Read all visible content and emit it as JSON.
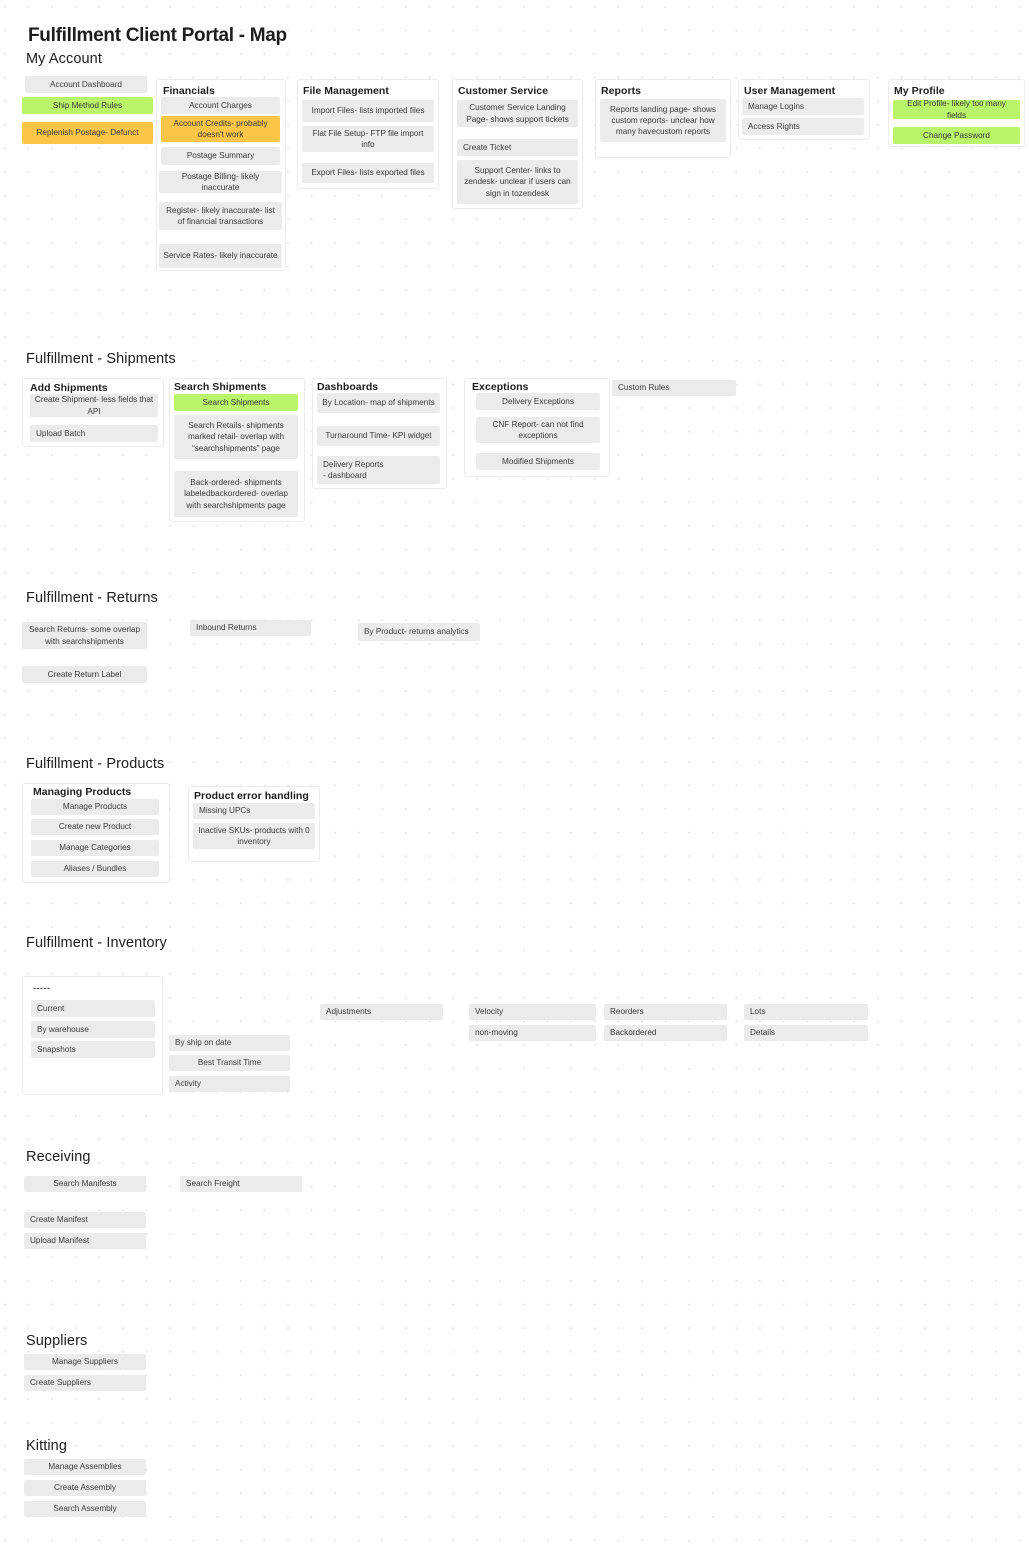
{
  "page": {
    "title": "Fulfillment Client Portal - Map",
    "colors": {
      "chip_default": "#ebebeb",
      "chip_green": "#b9f46a",
      "chip_orange": "#fbc647",
      "group_border": "#ececec",
      "dot_grid": "#e3e3e6",
      "background": "#ffffff",
      "text": "#3a3a3a"
    }
  },
  "sections": {
    "my_account": {
      "title": "My Account",
      "loose_items": [
        {
          "label": "Account Dashboard",
          "style": "default"
        },
        {
          "label": "Ship Method Rules",
          "style": "green"
        },
        {
          "label": "Replenish Postage- Defunct",
          "style": "orange"
        }
      ],
      "groups": [
        {
          "title": "Financials",
          "items": [
            {
              "label": "Account Charges",
              "style": "default"
            },
            {
              "label": "Account Credits- probably doesn't work",
              "style": "orange"
            },
            {
              "label": "Postage Summary",
              "style": "default"
            },
            {
              "label": "Postage Billing- likely inaccurate",
              "style": "default"
            },
            {
              "label": "Register- likely inaccurate- list of financial transactions",
              "style": "default"
            },
            {
              "label": "Service Rates- likely inaccurate",
              "style": "default"
            }
          ]
        },
        {
          "title": "File Management",
          "items": [
            {
              "label": "Import Files- lists imported files",
              "style": "default"
            },
            {
              "label": "Flat File Setup- FTP file import info",
              "style": "default"
            },
            {
              "label": "Export Files- lists exported files",
              "style": "default"
            }
          ]
        },
        {
          "title": "Customer Service",
          "items": [
            {
              "label": "Customer Service Landing Page- shows support tickets",
              "style": "default"
            },
            {
              "label": "Create Ticket",
              "style": "default"
            },
            {
              "label": "Support Center- links to zendesk- unclear if users can sign in tozendesk",
              "style": "default"
            }
          ]
        },
        {
          "title": "Reports",
          "items": [
            {
              "label": "Reports landing page- shows custom reports- unclear how many havecustom reports",
              "style": "default"
            }
          ]
        },
        {
          "title": "User Management",
          "items": [
            {
              "label": "Manage Logins",
              "style": "default"
            },
            {
              "label": "Access Rights",
              "style": "default"
            }
          ]
        },
        {
          "title": "My Profile",
          "items": [
            {
              "label": "Edit Profile- likely too many fields",
              "style": "green"
            },
            {
              "label": "Change Password",
              "style": "green"
            }
          ]
        }
      ]
    },
    "shipments": {
      "title": "Fulfillment - Shipments",
      "groups": [
        {
          "title": "Add Shipments",
          "items": [
            {
              "label": "Create Shipment- less fields that API",
              "style": "default"
            },
            {
              "label": "Upload Batch",
              "style": "default"
            }
          ]
        },
        {
          "title": "Search Shipments",
          "items": [
            {
              "label": "Search Shipments",
              "style": "green"
            },
            {
              "label": "Search Retails- shipments marked retail- overlap with “searchshipments” page",
              "style": "default"
            },
            {
              "label": "Back-ordered- shipments labeledbackordered- overlap with searchshipments page",
              "style": "default"
            }
          ]
        },
        {
          "title": "Dashboards",
          "items": [
            {
              "label": "By Location- map of shipments",
              "style": "default"
            },
            {
              "label": "Turnaround Time- KPI widget",
              "style": "default"
            },
            {
              "label": "Delivery Reports\n- dashboard",
              "style": "default"
            }
          ]
        },
        {
          "title": "Exceptions",
          "items": [
            {
              "label": "Delivery Exceptions",
              "style": "default"
            },
            {
              "label": "CNF Report- can not find exceptions",
              "style": "default"
            },
            {
              "label": "Modified Shipments",
              "style": "default"
            }
          ]
        }
      ],
      "loose_items": [
        {
          "label": "Custom Rules",
          "style": "default"
        }
      ]
    },
    "returns": {
      "title": "Fulfillment - Returns",
      "loose_items": [
        {
          "label": "Search Returns- some overlap with searchshipments",
          "style": "default"
        },
        {
          "label": "Create Return Label",
          "style": "default"
        },
        {
          "label": "Inbound Returns",
          "style": "default"
        },
        {
          "label": "By Product- returns analytics",
          "style": "default"
        }
      ]
    },
    "products": {
      "title": "Fulfillment - Products",
      "groups": [
        {
          "title": "Managing Products",
          "items": [
            {
              "label": "Manage Products",
              "style": "default"
            },
            {
              "label": "Create new Product",
              "style": "default"
            },
            {
              "label": "Manage Categories",
              "style": "default"
            },
            {
              "label": "Aliases / Bundles",
              "style": "default"
            }
          ]
        },
        {
          "title": "Product error handling",
          "items": [
            {
              "label": "Missing UPCs",
              "style": "default"
            },
            {
              "label": "Inactive SKUs- products with 0 inventory",
              "style": "default"
            }
          ]
        }
      ]
    },
    "inventory": {
      "title": "Fulfillment - Inventory",
      "groups": [
        {
          "title": "-----",
          "items": [
            {
              "label": "Current",
              "style": "default"
            },
            {
              "label": "By warehouse",
              "style": "default"
            },
            {
              "label": "Snapshots",
              "style": "default"
            }
          ]
        }
      ],
      "loose_items": [
        {
          "label": "By ship on date",
          "style": "default"
        },
        {
          "label": "Best Transit Time",
          "style": "default"
        },
        {
          "label": "Activity",
          "style": "default"
        },
        {
          "label": "Adjustments",
          "style": "default"
        },
        {
          "label": "Velocity",
          "style": "default"
        },
        {
          "label": "non-moving",
          "style": "default"
        },
        {
          "label": "Reorders",
          "style": "default"
        },
        {
          "label": "Backordered",
          "style": "default"
        },
        {
          "label": "Lots",
          "style": "default"
        },
        {
          "label": "Details",
          "style": "default"
        }
      ]
    },
    "receiving": {
      "title": "Receiving",
      "loose_items": [
        {
          "label": "Search Manifests",
          "style": "default"
        },
        {
          "label": "Search Freight",
          "style": "default"
        },
        {
          "label": "Create Manifest",
          "style": "default"
        },
        {
          "label": "Upload Manifest",
          "style": "default"
        }
      ]
    },
    "suppliers": {
      "title": "Suppliers",
      "loose_items": [
        {
          "label": "Manage Suppliers",
          "style": "default"
        },
        {
          "label": "Create Suppliers",
          "style": "default"
        }
      ]
    },
    "kitting": {
      "title": "Kitting",
      "loose_items": [
        {
          "label": "Manage Assemblies",
          "style": "default"
        },
        {
          "label": "Create Assembly",
          "style": "default"
        },
        {
          "label": "Search Assembly",
          "style": "default"
        }
      ]
    }
  }
}
